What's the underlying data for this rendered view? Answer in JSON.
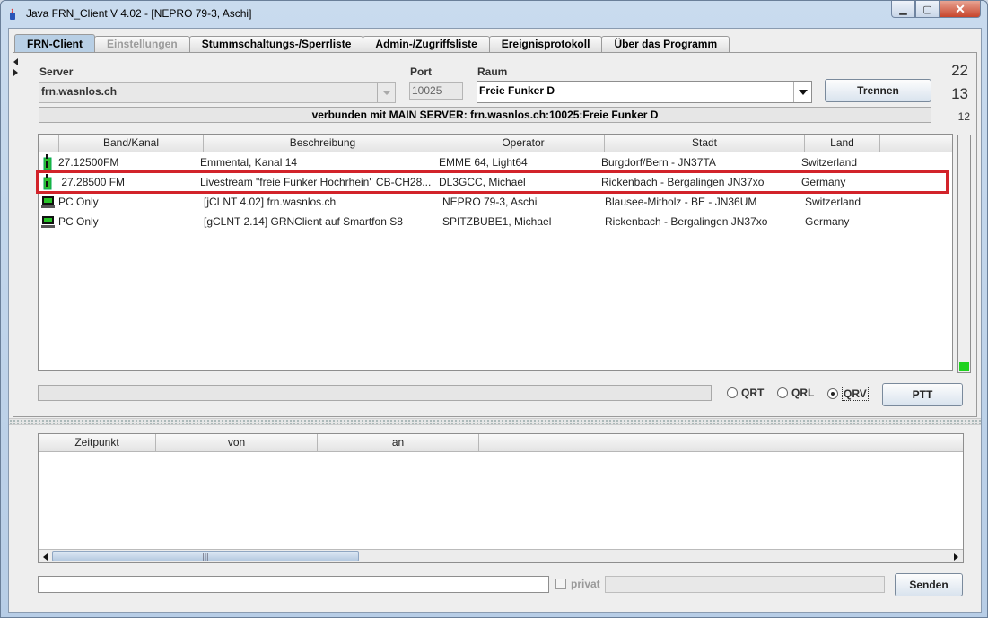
{
  "window": {
    "title": "Java FRN_Client V 4.02 - [NEPRO 79-3, Aschi]",
    "controls": {
      "minimize": "▁",
      "maximize": "▢",
      "close": "✕"
    }
  },
  "tabs": [
    {
      "label": "FRN-Client",
      "state": "active"
    },
    {
      "label": "Einstellungen",
      "state": "disabled"
    },
    {
      "label": "Stummschaltungs-/Sperrliste",
      "state": "normal"
    },
    {
      "label": "Admin-/Zugriffsliste",
      "state": "normal"
    },
    {
      "label": "Ereignisprotokoll",
      "state": "normal"
    },
    {
      "label": "Über das Programm",
      "state": "normal"
    }
  ],
  "connection": {
    "server_label": "Server",
    "server_value": "frn.wasnlos.ch",
    "port_label": "Port",
    "port_value": "10025",
    "room_label": "Raum",
    "room_value": "Freie Funker D",
    "disconnect_button": "Trennen",
    "status_text": "verbunden mit  MAIN SERVER: frn.wasnlos.ch:10025:Freie Funker D"
  },
  "counts": {
    "first": "22",
    "second": "13",
    "third": "12"
  },
  "clients_table": {
    "columns": [
      "Band/Kanal",
      "Beschreibung",
      "Operator",
      "Stadt",
      "Land"
    ],
    "rows": [
      {
        "icon": "radio-icon",
        "band": "27.12500FM",
        "beschreibung": "Emmental, Kanal 14",
        "operator": "EMME 64, Light64",
        "stadt": "Burgdorf/Bern - JN37TA",
        "land": "Switzerland"
      },
      {
        "icon": "radio-icon",
        "band": " 27.28500 FM",
        "beschreibung": "Livestream \"freie Funker Hochrhein\" CB-CH28...",
        "operator": "DL3GCC, Michael",
        "stadt": "Rickenbach - Bergalingen JN37xo",
        "land": "Germany"
      },
      {
        "icon": "pc-icon",
        "band": "PC Only",
        "beschreibung": "[jCLNT 4.02] frn.wasnlos.ch",
        "operator": "NEPRO 79-3, Aschi",
        "stadt": "Blausee-Mitholz - BE - JN36UM",
        "land": "Switzerland"
      },
      {
        "icon": "pc-icon",
        "band": "PC Only",
        "beschreibung": "[gCLNT 2.14] GRNClient auf Smartfon S8",
        "operator": "SPITZBUBE1, Michael",
        "stadt": "Rickenbach - Bergalingen JN37xo",
        "land": "Germany"
      }
    ]
  },
  "level_meter": 0.04,
  "modes": {
    "qrt": "QRT",
    "qrl": "QRL",
    "qrv": "QRV",
    "selected": "QRV"
  },
  "ptt_button": "PTT",
  "messages_table": {
    "columns": [
      "Zeitpunkt",
      "von",
      "an"
    ]
  },
  "message_input": {
    "value": "",
    "private_label": "privat",
    "send_button": "Senden"
  },
  "colors": {
    "highlight": "#d2232a",
    "level": "#1fd21f",
    "active_tab": "#b8cfe5"
  }
}
